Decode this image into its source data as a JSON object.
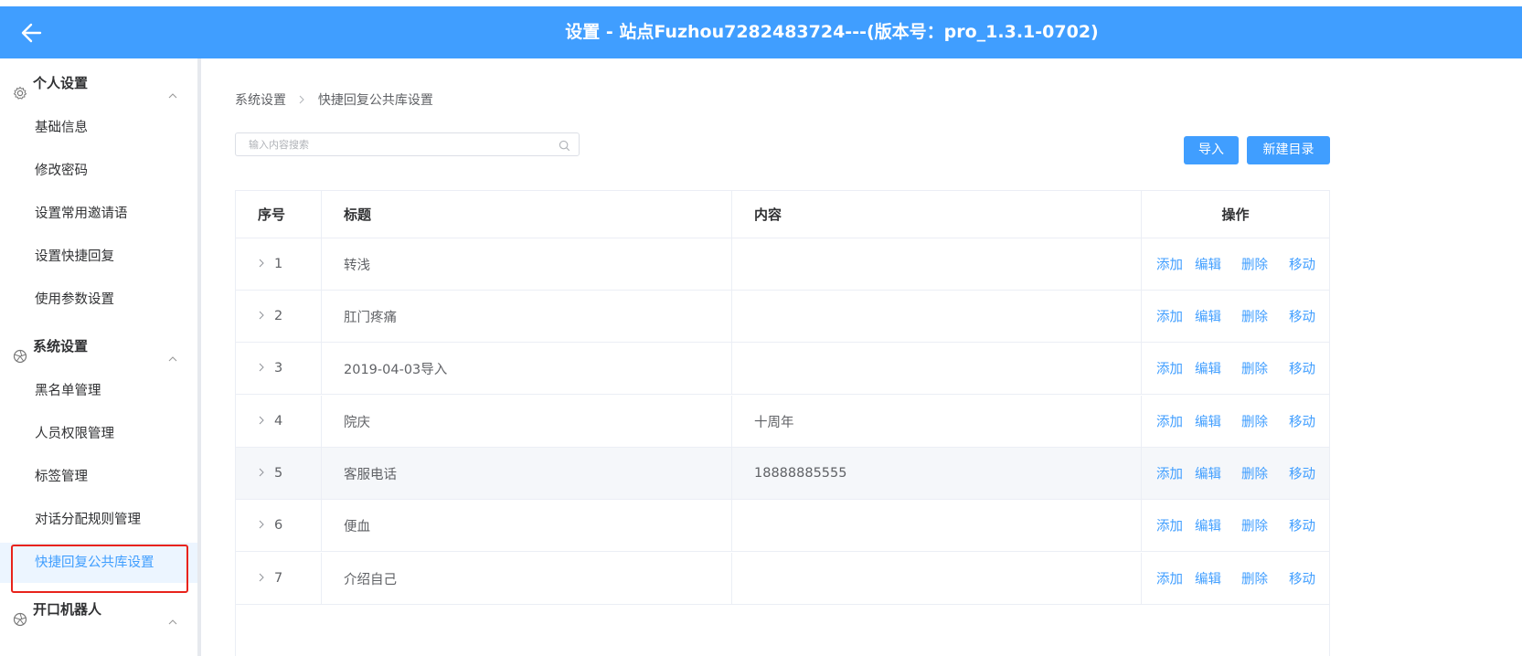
{
  "header": {
    "title": "设置 - 站点Fuzhou7282483724---(版本号：pro_1.3.1-0702)",
    "bg_color": "#409eff"
  },
  "sidebar": {
    "groups": [
      {
        "label": "个人设置",
        "icon": "gear-icon",
        "items": [
          "基础信息",
          "修改密码",
          "设置常用邀请语",
          "设置快捷回复",
          "使用参数设置"
        ]
      },
      {
        "label": "系统设置",
        "icon": "aperture-icon",
        "items": [
          "黑名单管理",
          "人员权限管理",
          "标签管理",
          "对话分配规则管理",
          "快捷回复公共库设置"
        ]
      },
      {
        "label": "开口机器人",
        "icon": "aperture-icon",
        "items": []
      }
    ],
    "active_item": "快捷回复公共库设置",
    "active_color": "#409eff"
  },
  "breadcrumb": [
    "系统设置",
    "快捷回复公共库设置"
  ],
  "search": {
    "placeholder": "输入内容搜索",
    "value": ""
  },
  "buttons": {
    "import": "导入",
    "new_dir": "新建目录"
  },
  "table": {
    "headers": {
      "no": "序号",
      "title": "标题",
      "content": "内容",
      "ops": "操作"
    },
    "op_labels": [
      "添加",
      "编辑",
      "删除",
      "移动"
    ],
    "rows": [
      {
        "no": "1",
        "title": "转浅",
        "content": ""
      },
      {
        "no": "2",
        "title": "肛门疼痛",
        "content": ""
      },
      {
        "no": "3",
        "title": "2019-04-03导入",
        "content": ""
      },
      {
        "no": "4",
        "title": "院庆",
        "content": "十周年"
      },
      {
        "no": "5",
        "title": "客服电话",
        "content": "18888885555"
      },
      {
        "no": "6",
        "title": "便血",
        "content": ""
      },
      {
        "no": "7",
        "title": "介绍自己",
        "content": ""
      }
    ],
    "hover_row": 5
  }
}
